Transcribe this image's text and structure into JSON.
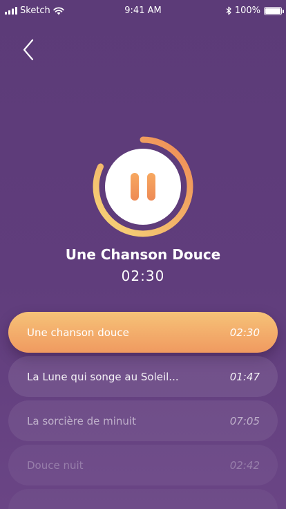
{
  "status_bar": {
    "carrier": "Sketch",
    "time": "9:41 AM",
    "battery": "100%"
  },
  "navigation": {
    "back_icon": "chevron-left-icon"
  },
  "player": {
    "state": "playing",
    "control_icon": "pause-icon",
    "progress": 0.82,
    "title": "Une Chanson Douce",
    "elapsed": "02:30",
    "colors": {
      "accent_start": "#f7d87a",
      "accent_end": "#ee8a55",
      "background": "#5c3b78"
    }
  },
  "playlist": [
    {
      "title": "Une chanson douce",
      "duration": "02:30",
      "active": true
    },
    {
      "title": "La Lune qui songe au Soleil...",
      "duration": "01:47",
      "active": false
    },
    {
      "title": "La sorcière de minuit",
      "duration": "07:05",
      "active": false
    },
    {
      "title": "Douce nuit",
      "duration": "02:42",
      "active": false
    },
    {
      "title": "",
      "duration": "",
      "active": false
    }
  ]
}
